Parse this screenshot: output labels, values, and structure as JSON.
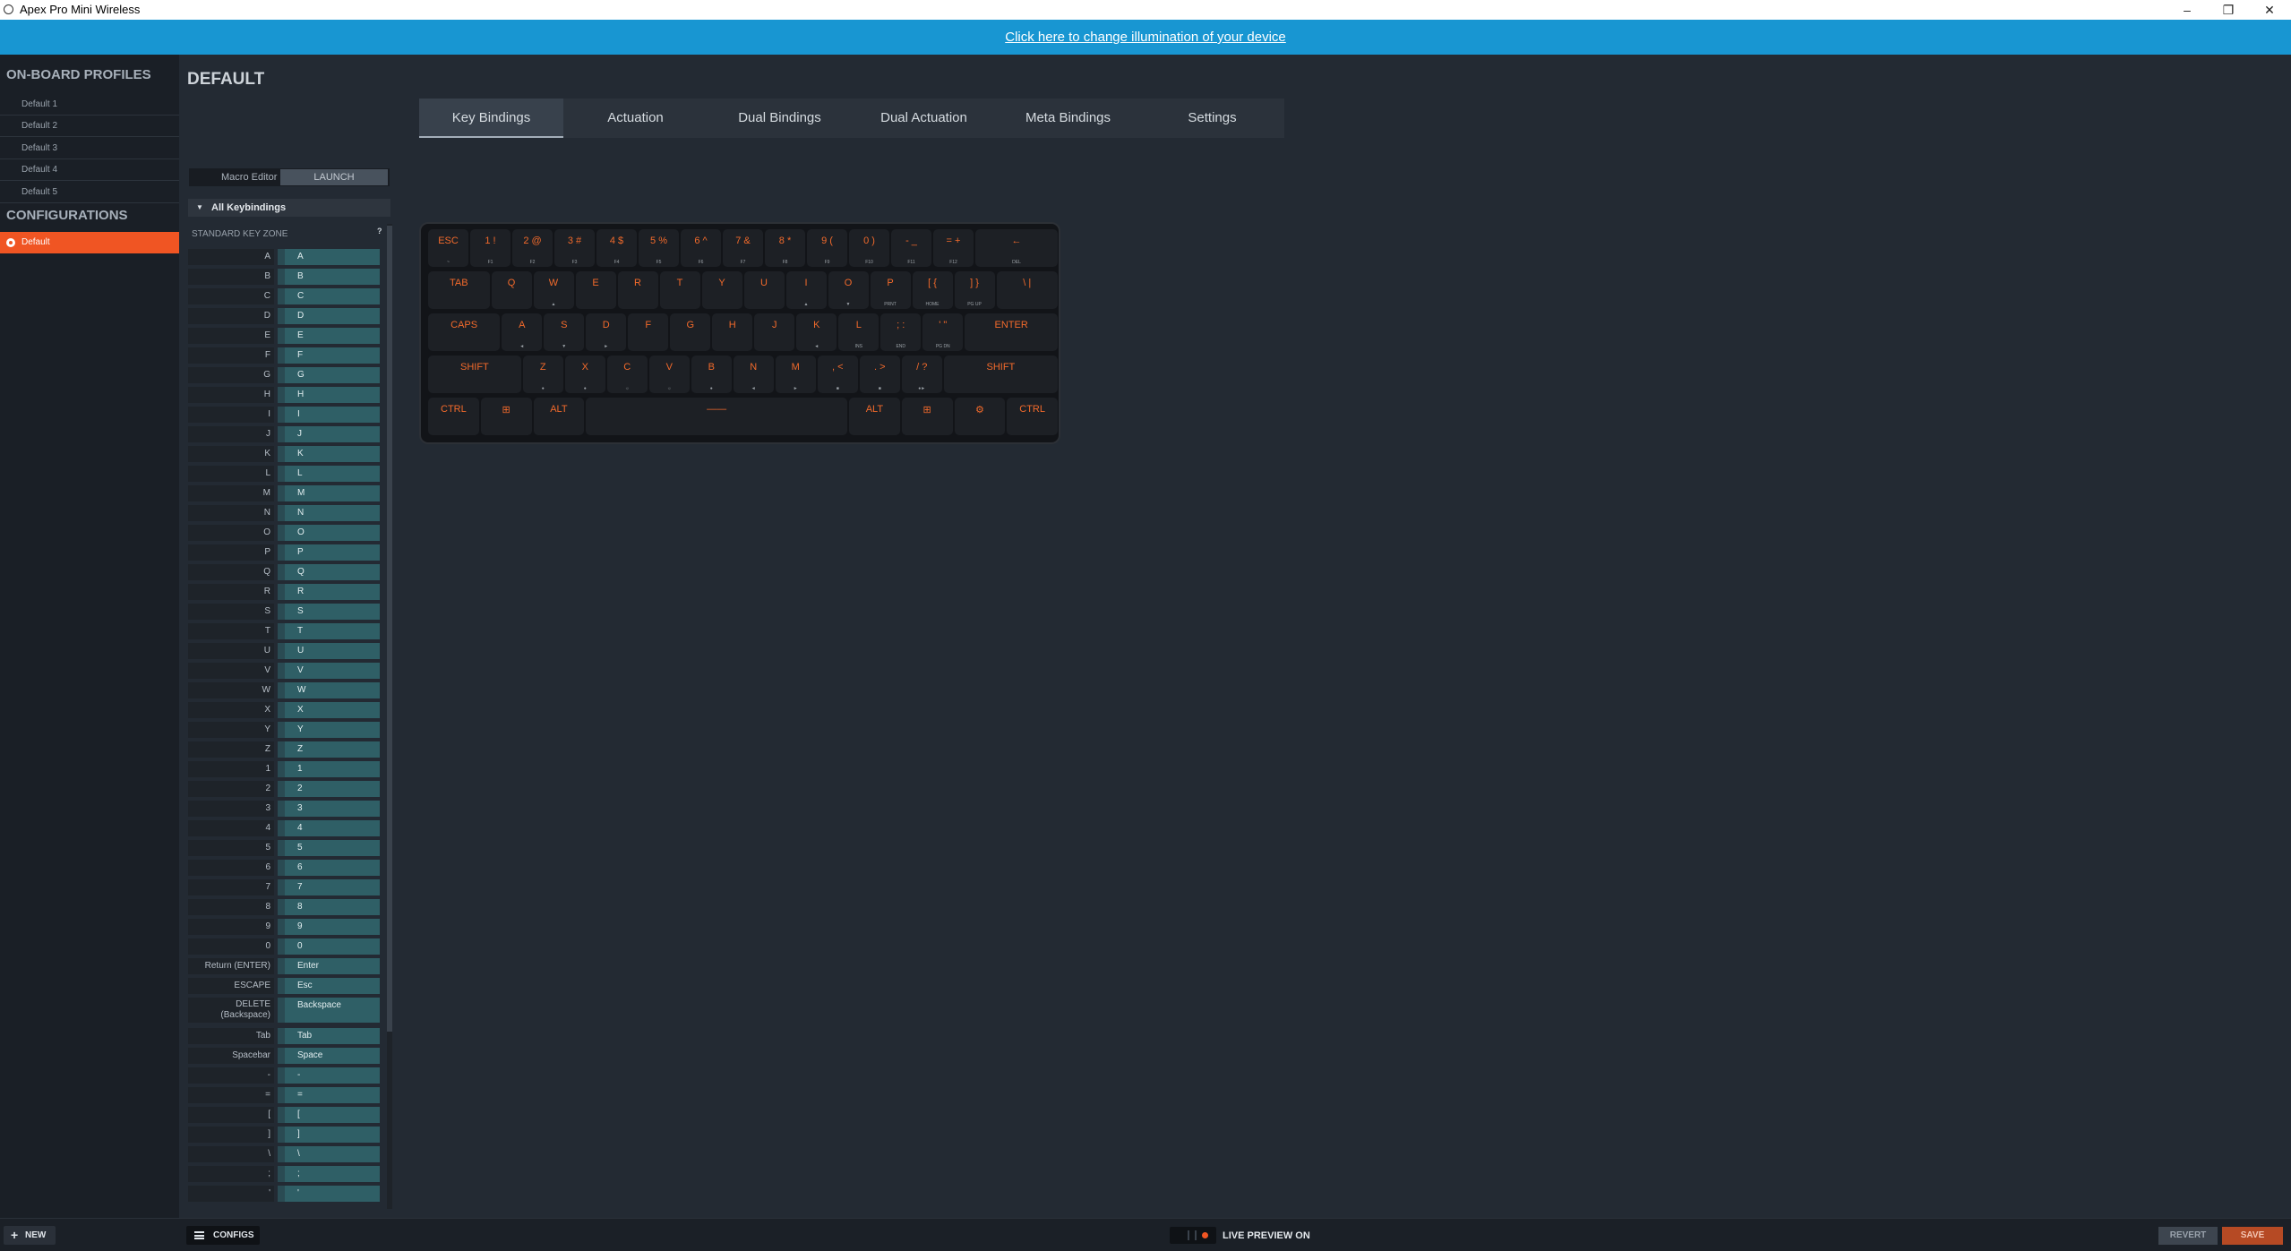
{
  "window": {
    "title": "Apex Pro Mini Wireless",
    "minimize": "–",
    "restore": "❐",
    "close": "✕"
  },
  "banner": {
    "text": "Click here to change illumination of your device"
  },
  "sidebar": {
    "profiles_title": "ON-BOARD PROFILES",
    "profiles": [
      "Default 1",
      "Default 2",
      "Default 3",
      "Default 4",
      "Default 5"
    ],
    "configs_title": "CONFIGURATIONS",
    "configs": [
      "Default"
    ]
  },
  "main": {
    "title": "DEFAULT",
    "tabs": [
      "Key Bindings",
      "Actuation",
      "Dual Bindings",
      "Dual Actuation",
      "Meta Bindings",
      "Settings"
    ]
  },
  "macro": {
    "label": "Macro Editor",
    "launch": "LAUNCH"
  },
  "keybindings": {
    "filter": "All Keybindings",
    "zone": "STANDARD KEY ZONE",
    "help": "?",
    "rows": [
      {
        "name": "A",
        "value": "A"
      },
      {
        "name": "B",
        "value": "B"
      },
      {
        "name": "C",
        "value": "C"
      },
      {
        "name": "D",
        "value": "D"
      },
      {
        "name": "E",
        "value": "E"
      },
      {
        "name": "F",
        "value": "F"
      },
      {
        "name": "G",
        "value": "G"
      },
      {
        "name": "H",
        "value": "H"
      },
      {
        "name": "I",
        "value": "I"
      },
      {
        "name": "J",
        "value": "J"
      },
      {
        "name": "K",
        "value": "K"
      },
      {
        "name": "L",
        "value": "L"
      },
      {
        "name": "M",
        "value": "M"
      },
      {
        "name": "N",
        "value": "N"
      },
      {
        "name": "O",
        "value": "O"
      },
      {
        "name": "P",
        "value": "P"
      },
      {
        "name": "Q",
        "value": "Q"
      },
      {
        "name": "R",
        "value": "R"
      },
      {
        "name": "S",
        "value": "S"
      },
      {
        "name": "T",
        "value": "T"
      },
      {
        "name": "U",
        "value": "U"
      },
      {
        "name": "V",
        "value": "V"
      },
      {
        "name": "W",
        "value": "W"
      },
      {
        "name": "X",
        "value": "X"
      },
      {
        "name": "Y",
        "value": "Y"
      },
      {
        "name": "Z",
        "value": "Z"
      },
      {
        "name": "1",
        "value": "1"
      },
      {
        "name": "2",
        "value": "2"
      },
      {
        "name": "3",
        "value": "3"
      },
      {
        "name": "4",
        "value": "4"
      },
      {
        "name": "5",
        "value": "5"
      },
      {
        "name": "6",
        "value": "6"
      },
      {
        "name": "7",
        "value": "7"
      },
      {
        "name": "8",
        "value": "8"
      },
      {
        "name": "9",
        "value": "9"
      },
      {
        "name": "0",
        "value": "0"
      },
      {
        "name": "Return (ENTER)",
        "value": "Enter"
      },
      {
        "name": "ESCAPE",
        "value": "Esc"
      },
      {
        "name": "DELETE\n(Backspace)",
        "value": "Backspace",
        "tall": true
      },
      {
        "name": "Tab",
        "value": "Tab"
      },
      {
        "name": "Spacebar",
        "value": "Space"
      },
      {
        "name": "-",
        "value": "-"
      },
      {
        "name": "=",
        "value": "="
      },
      {
        "name": "[",
        "value": "["
      },
      {
        "name": "]",
        "value": "]"
      },
      {
        "name": "\\",
        "value": "\\"
      },
      {
        "name": ";",
        "value": ";"
      },
      {
        "name": "'",
        "value": "'"
      }
    ]
  },
  "keyboard_rows": [
    [
      {
        "l": "ESC",
        "s": "~"
      },
      {
        "l": "1 !",
        "s": "F1"
      },
      {
        "l": "2 @",
        "s": "F2"
      },
      {
        "l": "3 #",
        "s": "F3"
      },
      {
        "l": "4 $",
        "s": "F4"
      },
      {
        "l": "5 %",
        "s": "F5"
      },
      {
        "l": "6 ^",
        "s": "F6"
      },
      {
        "l": "7 &",
        "s": "F7"
      },
      {
        "l": "8 *",
        "s": "F8"
      },
      {
        "l": "9 (",
        "s": "F9"
      },
      {
        "l": "0 )",
        "s": "F10"
      },
      {
        "l": "- _",
        "s": "F11"
      },
      {
        "l": "= +",
        "s": "F12"
      },
      {
        "l": "←",
        "s": "DEL",
        "w": 2
      }
    ],
    [
      {
        "l": "TAB",
        "w": 1.5
      },
      {
        "l": "Q"
      },
      {
        "l": "W",
        "s": "▲"
      },
      {
        "l": "E"
      },
      {
        "l": "R"
      },
      {
        "l": "T"
      },
      {
        "l": "Y"
      },
      {
        "l": "U"
      },
      {
        "l": "I",
        "s": "▲"
      },
      {
        "l": "O",
        "s": "▼"
      },
      {
        "l": "P",
        "s": "PRNT"
      },
      {
        "l": "[ {",
        "s": "HOME"
      },
      {
        "l": "] }",
        "s": "PG UP"
      },
      {
        "l": "\\ |",
        "w": 1.5
      }
    ],
    [
      {
        "l": "CAPS",
        "w": 1.75
      },
      {
        "l": "A",
        "s": "◄"
      },
      {
        "l": "S",
        "s": "▼"
      },
      {
        "l": "D",
        "s": "►"
      },
      {
        "l": "F"
      },
      {
        "l": "G"
      },
      {
        "l": "H"
      },
      {
        "l": "J"
      },
      {
        "l": "K",
        "s": "◄"
      },
      {
        "l": "L",
        "s": "INS"
      },
      {
        "l": "; :",
        "s": "END"
      },
      {
        "l": "' \"",
        "s": "PG DN"
      },
      {
        "l": "ENTER",
        "w": 2.25
      }
    ],
    [
      {
        "l": "SHIFT",
        "w": 2.25
      },
      {
        "l": "Z",
        "s": "●"
      },
      {
        "l": "X",
        "s": "●"
      },
      {
        "l": "C",
        "s": "☼"
      },
      {
        "l": "V",
        "s": "☼"
      },
      {
        "l": "B",
        "s": "●"
      },
      {
        "l": "N",
        "s": "◄"
      },
      {
        "l": "M",
        "s": "►"
      },
      {
        "l": ", <",
        "s": "■"
      },
      {
        "l": ". >",
        "s": "■"
      },
      {
        "l": "/ ?",
        "s": "●►"
      },
      {
        "l": "SHIFT",
        "w": 2.75
      }
    ],
    [
      {
        "l": "CTRL",
        "w": 1.25
      },
      {
        "l": "⊞",
        "w": 1.25
      },
      {
        "l": "ALT",
        "w": 1.25
      },
      {
        "l": "——",
        "w": 6.25
      },
      {
        "l": "ALT",
        "w": 1.25
      },
      {
        "l": "⊞",
        "w": 1.25
      },
      {
        "l": "⚙",
        "w": 1.25
      },
      {
        "l": "CTRL",
        "w": 1.25
      }
    ]
  ],
  "bottom": {
    "new": "NEW",
    "configs": "CONFIGS",
    "live": "LIVE PREVIEW ON",
    "revert": "REVERT",
    "save": "SAVE"
  }
}
